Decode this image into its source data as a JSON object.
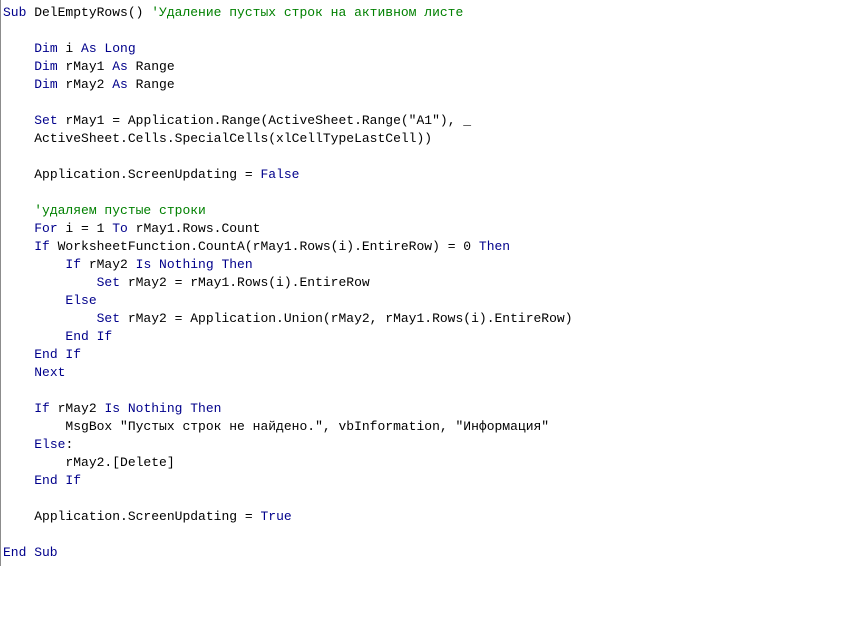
{
  "lines": [
    {
      "indent": 0,
      "tokens": [
        {
          "t": "Sub",
          "c": "kw"
        },
        {
          "t": " DelEmptyRows() ",
          "c": "tx"
        },
        {
          "t": "'Удаление пустых строк на активном листе",
          "c": "cm"
        }
      ]
    },
    {
      "indent": 0,
      "blank": true
    },
    {
      "indent": 1,
      "tokens": [
        {
          "t": "Dim",
          "c": "kw"
        },
        {
          "t": " i ",
          "c": "tx"
        },
        {
          "t": "As Long",
          "c": "kw"
        }
      ]
    },
    {
      "indent": 1,
      "tokens": [
        {
          "t": "Dim",
          "c": "kw"
        },
        {
          "t": " rMay1 ",
          "c": "tx"
        },
        {
          "t": "As",
          "c": "kw"
        },
        {
          "t": " Range",
          "c": "tx"
        }
      ]
    },
    {
      "indent": 1,
      "tokens": [
        {
          "t": "Dim",
          "c": "kw"
        },
        {
          "t": " rMay2 ",
          "c": "tx"
        },
        {
          "t": "As",
          "c": "kw"
        },
        {
          "t": " Range",
          "c": "tx"
        }
      ]
    },
    {
      "indent": 0,
      "blank": true
    },
    {
      "indent": 1,
      "tokens": [
        {
          "t": "Set",
          "c": "kw"
        },
        {
          "t": " rMay1 = Application.Range(ActiveSheet.Range(\"A1\"), _",
          "c": "tx"
        }
      ]
    },
    {
      "indent": 1,
      "tokens": [
        {
          "t": "ActiveSheet.Cells.SpecialCells(xlCellTypeLastCell))",
          "c": "tx"
        }
      ]
    },
    {
      "indent": 0,
      "blank": true
    },
    {
      "indent": 1,
      "tokens": [
        {
          "t": "Application.ScreenUpdating = ",
          "c": "tx"
        },
        {
          "t": "False",
          "c": "kw"
        }
      ]
    },
    {
      "indent": 0,
      "blank": true
    },
    {
      "indent": 1,
      "tokens": [
        {
          "t": "'удаляем пустые строки",
          "c": "cm"
        }
      ]
    },
    {
      "indent": 1,
      "tokens": [
        {
          "t": "For",
          "c": "kw"
        },
        {
          "t": " i = 1 ",
          "c": "tx"
        },
        {
          "t": "To",
          "c": "kw"
        },
        {
          "t": " rMay1.Rows.Count",
          "c": "tx"
        }
      ]
    },
    {
      "indent": 1,
      "tokens": [
        {
          "t": "If",
          "c": "kw"
        },
        {
          "t": " WorksheetFunction.CountA(rMay1.Rows(i).EntireRow) = 0 ",
          "c": "tx"
        },
        {
          "t": "Then",
          "c": "kw"
        }
      ]
    },
    {
      "indent": 2,
      "tokens": [
        {
          "t": "If",
          "c": "kw"
        },
        {
          "t": " rMay2 ",
          "c": "tx"
        },
        {
          "t": "Is Nothing Then",
          "c": "kw"
        }
      ]
    },
    {
      "indent": 3,
      "tokens": [
        {
          "t": "Set",
          "c": "kw"
        },
        {
          "t": " rMay2 = rMay1.Rows(i).EntireRow",
          "c": "tx"
        }
      ]
    },
    {
      "indent": 2,
      "tokens": [
        {
          "t": "Else",
          "c": "kw"
        }
      ]
    },
    {
      "indent": 3,
      "tokens": [
        {
          "t": "Set",
          "c": "kw"
        },
        {
          "t": " rMay2 = Application.Union(rMay2, rMay1.Rows(i).EntireRow)",
          "c": "tx"
        }
      ]
    },
    {
      "indent": 2,
      "tokens": [
        {
          "t": "End If",
          "c": "kw"
        }
      ]
    },
    {
      "indent": 1,
      "tokens": [
        {
          "t": "End If",
          "c": "kw"
        }
      ]
    },
    {
      "indent": 1,
      "tokens": [
        {
          "t": "Next",
          "c": "kw"
        }
      ]
    },
    {
      "indent": 0,
      "blank": true
    },
    {
      "indent": 1,
      "tokens": [
        {
          "t": "If",
          "c": "kw"
        },
        {
          "t": " rMay2 ",
          "c": "tx"
        },
        {
          "t": "Is Nothing Then",
          "c": "kw"
        }
      ]
    },
    {
      "indent": 2,
      "tokens": [
        {
          "t": "MsgBox \"Пустых строк не найдено.\", vbInformation, \"Информация\"",
          "c": "tx"
        }
      ]
    },
    {
      "indent": 1,
      "tokens": [
        {
          "t": "Else",
          "c": "kw"
        },
        {
          "t": ":",
          "c": "tx"
        }
      ]
    },
    {
      "indent": 2,
      "tokens": [
        {
          "t": "rMay2.[Delete]",
          "c": "tx"
        }
      ]
    },
    {
      "indent": 1,
      "tokens": [
        {
          "t": "End If",
          "c": "kw"
        }
      ]
    },
    {
      "indent": 0,
      "blank": true
    },
    {
      "indent": 1,
      "tokens": [
        {
          "t": "Application.ScreenUpdating = ",
          "c": "tx"
        },
        {
          "t": "True",
          "c": "kw"
        }
      ]
    },
    {
      "indent": 0,
      "blank": true
    },
    {
      "indent": 0,
      "tokens": [
        {
          "t": "End Sub",
          "c": "kw"
        }
      ]
    }
  ],
  "indent_unit": "    "
}
